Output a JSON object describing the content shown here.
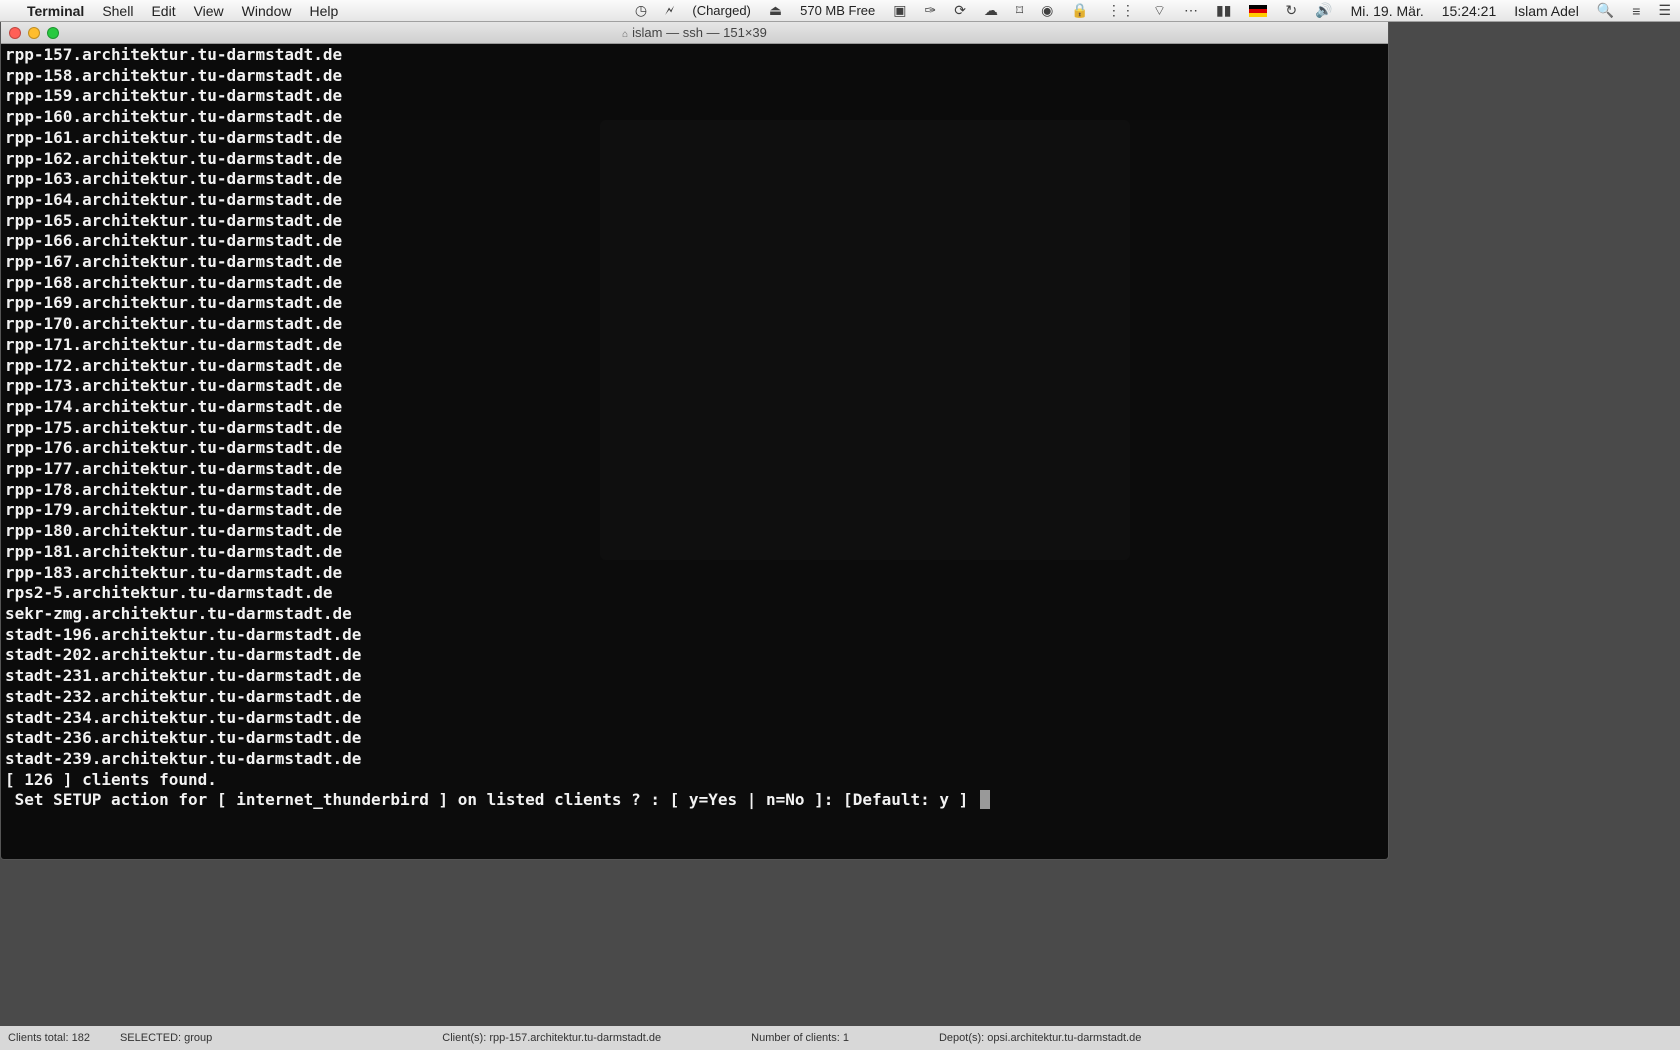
{
  "menubar": {
    "app": "Terminal",
    "menus": [
      "Shell",
      "Edit",
      "View",
      "Window",
      "Help"
    ],
    "battery": "(Charged)",
    "mem": "570 MB Free",
    "date": "Mi. 19. Mär.",
    "time": "15:24:21",
    "user": "Islam Adel"
  },
  "window": {
    "title": "islam — ssh — 151×39",
    "home_glyph": "⌂"
  },
  "terminal": {
    "lines": [
      "rpp-157.architektur.tu-darmstadt.de",
      "rpp-158.architektur.tu-darmstadt.de",
      "rpp-159.architektur.tu-darmstadt.de",
      "rpp-160.architektur.tu-darmstadt.de",
      "rpp-161.architektur.tu-darmstadt.de",
      "rpp-162.architektur.tu-darmstadt.de",
      "rpp-163.architektur.tu-darmstadt.de",
      "rpp-164.architektur.tu-darmstadt.de",
      "rpp-165.architektur.tu-darmstadt.de",
      "rpp-166.architektur.tu-darmstadt.de",
      "rpp-167.architektur.tu-darmstadt.de",
      "rpp-168.architektur.tu-darmstadt.de",
      "rpp-169.architektur.tu-darmstadt.de",
      "rpp-170.architektur.tu-darmstadt.de",
      "rpp-171.architektur.tu-darmstadt.de",
      "rpp-172.architektur.tu-darmstadt.de",
      "rpp-173.architektur.tu-darmstadt.de",
      "rpp-174.architektur.tu-darmstadt.de",
      "rpp-175.architektur.tu-darmstadt.de",
      "rpp-176.architektur.tu-darmstadt.de",
      "rpp-177.architektur.tu-darmstadt.de",
      "rpp-178.architektur.tu-darmstadt.de",
      "rpp-179.architektur.tu-darmstadt.de",
      "rpp-180.architektur.tu-darmstadt.de",
      "rpp-181.architektur.tu-darmstadt.de",
      "rpp-183.architektur.tu-darmstadt.de",
      "rps2-5.architektur.tu-darmstadt.de",
      "sekr-zmg.architektur.tu-darmstadt.de",
      "stadt-196.architektur.tu-darmstadt.de",
      "stadt-202.architektur.tu-darmstadt.de",
      "stadt-231.architektur.tu-darmstadt.de",
      "stadt-232.architektur.tu-darmstadt.de",
      "stadt-234.architektur.tu-darmstadt.de",
      "stadt-236.architektur.tu-darmstadt.de",
      "stadt-239.architektur.tu-darmstadt.de",
      "",
      "[ 126 ] clients found.",
      ""
    ],
    "prompt": " Set SETUP action for [ internet_thunderbird ] on listed clients ? : [ y=Yes | n=No ]: [Default: y ] "
  },
  "background_bar": {
    "clients_total": "Clients total: 182",
    "selected": "SELECTED: group",
    "client": "Client(s): rpp-157.architektur.tu-darmstadt.de",
    "number": "Number of clients: 1",
    "depots": "Depot(s): opsi.architektur.tu-darmstadt.de"
  }
}
